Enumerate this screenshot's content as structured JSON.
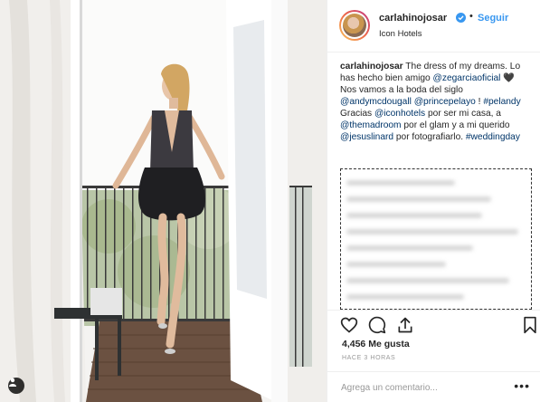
{
  "photo": {
    "alt_icon": "person-tag-icon"
  },
  "header": {
    "username": "carlahinojosar",
    "verified": true,
    "separator": "•",
    "follow_label": "Seguir",
    "location": "Icon Hotels"
  },
  "caption": {
    "username": "carlahinojosar",
    "part1": " The dress of my dreams. Lo has hecho bien amigo ",
    "mention1": "@zegarciaoficial",
    "part2": " 🖤 Nos vamos a la boda del siglo ",
    "mention2": "@andymcdougall",
    "part3": " ",
    "mention3": "@princepelayo",
    "part4": " ! ",
    "hashtag1": "#pelandy",
    "part5": " Gracias ",
    "mention4": "@iconhotels",
    "part6": " por ser mi casa, a ",
    "mention5": "@themadroom",
    "part7": " por el glam y a mi querido ",
    "mention6": "@jesuslinard",
    "part8": " por fotografiarlo. ",
    "hashtag2": "#weddingday"
  },
  "actions": {
    "like_icon": "heart-icon",
    "comment_icon": "comment-icon",
    "share_icon": "share-icon",
    "save_icon": "bookmark-icon"
  },
  "likes": "4,456 Me gusta",
  "time_ago": "HACE 3 HORAS",
  "comment": {
    "placeholder": "Agrega un comentario...",
    "more_label": "•••"
  },
  "colors": {
    "accent": "#3897f0",
    "link": "#003569",
    "border": "#efefef",
    "muted": "#999999"
  }
}
